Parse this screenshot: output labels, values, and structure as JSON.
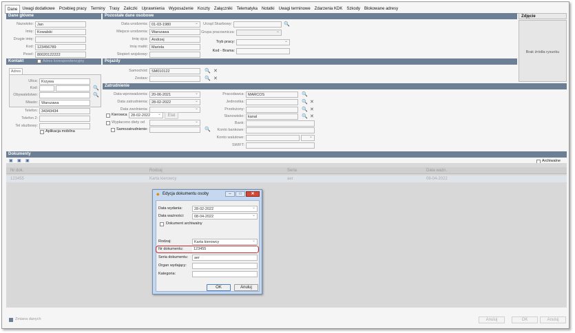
{
  "tabs": [
    "Dane",
    "Uwagi dodatkowe",
    "Przebieg pracy",
    "Terminy",
    "Trasy",
    "Zaliczki",
    "Uprawnienia",
    "Wyposażenie",
    "Koszty",
    "Załączniki",
    "Telematyka",
    "Notatki",
    "Uwagi terminowe",
    "Zdarzenia KDK",
    "Szkody",
    "Blokowane adresy"
  ],
  "sections": {
    "main": "Dane główne",
    "other": "Pozostałe dane osobowe",
    "photo": "Zdjęcie",
    "contact": "Kontakt",
    "vehicles": "Pojazdy",
    "employment": "Zatrudnienie",
    "documents": "Dokumenty"
  },
  "main": {
    "surname_l": "Nazwisko:",
    "surname": "Jan",
    "name_l": "Imię:",
    "name": "Kowalski",
    "second_l": "Drugie imię:",
    "code_l": "Kod:",
    "code": "123456789",
    "pesel_l": "Pesel:",
    "pesel": "80020122222"
  },
  "other": {
    "dob_l": "Data urodzenia:",
    "dob": "01-03-1980",
    "office_l": "Urząd Skarbowy:",
    "pob_l": "Miejsce urodzenia:",
    "pob": "Warszawa",
    "group_l": "Grupa pracownicza:",
    "father_l": "Imię ojca:",
    "father": "Andrzej",
    "mode_l": "Tryb pracy:",
    "mother_l": "Imię matki:",
    "mother": "Mariola",
    "gate_l": "Kod - Brama:",
    "rank_l": "Stopień wojskowy:"
  },
  "photo": {
    "no_source": "Brak źródła rysunku"
  },
  "contact": {
    "corr": "Adres korespondencyjny",
    "addr_tab": "Adres",
    "street_l": "Ulica:",
    "street": "Krzywa",
    "zip_l": "Kod:",
    "country_l": "Obywatelstwo:",
    "city_l": "Miasto:",
    "city": "Warszawa",
    "phone_l": "Telefon:",
    "phone": "34343434",
    "phone2_l": "Telefon 2:",
    "work_l": "Tel służbowy:",
    "mobile": "Aplikacja mobilna"
  },
  "vehicles": {
    "car_l": "Samochód:",
    "car": "SM010122",
    "set_l": "Zestaw:"
  },
  "emp": {
    "intro_l": "Data wprowadzenia:",
    "intro": "20-06-2021",
    "hire_l": "Data zatrudnienia:",
    "hire": "28-02-2022",
    "fire_l": "Data zwolnienia:",
    "driver": "Kierowca",
    "driver_d": "28-02-2022",
    "status": "Etat",
    "diets": "Wypłacono diety od",
    "self": "Samozatrudnienie:",
    "employer_l": "Pracodawca:",
    "employer": "MARCOS",
    "unit_l": "Jednostka:",
    "sup_l": "Przełożony:",
    "pos_l": "Stanowisko:",
    "pos": "kanal",
    "bank_l": "Bank:",
    "acc_l": "Konto bankowe:",
    "fx_l": "Konto walutowe:",
    "swift_l": "SWIFT:"
  },
  "docs": {
    "archived": "Archiwalne",
    "cols": [
      "Nr dok.",
      "Rodzaj",
      "Seria",
      "Data ważn."
    ],
    "row": [
      "123455",
      "Karta kierowcy",
      "aer",
      "08-04-2022"
    ]
  },
  "bottom": {
    "changes": "Zmiana danych",
    "undo": "Anuluj",
    "ok": "OK",
    "cancel": "Anuluj"
  },
  "dialog": {
    "title": "Edycja dokumentu osoby",
    "issue_l": "Data wydania:",
    "issue": "28-02-2022",
    "valid_l": "Data ważności:",
    "valid": "08-04-2022",
    "archived": "Dokument archiwalny",
    "type_l": "Rodzaj:",
    "type": "Karta kierowcy",
    "nr_l": "Nr dokumentu:",
    "nr": "123455",
    "series_l": "Seria dokumentu:",
    "series": "aer",
    "org_l": "Organ wydający:",
    "cat_l": "Kategoria:",
    "ok": "OK",
    "cancel": "Anuluj"
  },
  "colors": {
    "header": "#6c7f95",
    "highlight": "#c0262c"
  }
}
